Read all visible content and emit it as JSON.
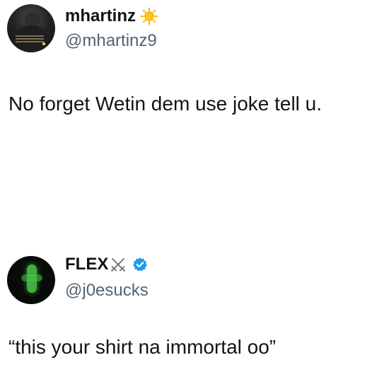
{
  "tweets": [
    {
      "display_name": "mhartinz",
      "name_emoji": "sun-icon",
      "handle": "@mhartinz9",
      "text": "No forget Wetin dem use joke tell u."
    },
    {
      "display_name": "FLEX",
      "name_emoji": "crossed-swords-icon",
      "verified": true,
      "handle": "@j0esucks",
      "text": "“this your shirt na immortal oo”"
    }
  ],
  "colors": {
    "name": "#0f1419",
    "handle": "#536471",
    "verified": "#1d9bf0",
    "sun": "#ffb300"
  }
}
